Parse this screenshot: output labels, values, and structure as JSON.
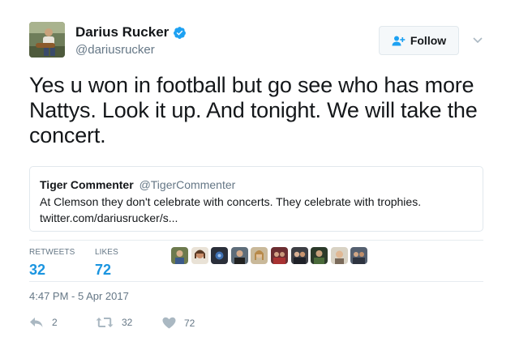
{
  "user": {
    "display_name": "Darius Rucker",
    "handle": "@dariusrucker"
  },
  "follow_label": "Follow",
  "tweet": {
    "text": "Yes u won in football but go see who has more Nattys. Look it up. And tonight. We will take the concert."
  },
  "quoted_tweet": {
    "display_name": "Tiger Commenter",
    "handle": "@TigerCommenter",
    "text": "At Clemson they don't celebrate with concerts. They celebrate with trophies.",
    "link": "twitter.com/dariusrucker/s..."
  },
  "stats": {
    "retweets_label": "RETWEETS",
    "retweets_count": "32",
    "likes_label": "LIKES",
    "likes_count": "72"
  },
  "timestamp": "4:47 PM - 5 Apr 2017",
  "actions": {
    "reply_count": "2",
    "retweet_count": "32",
    "like_count": "72"
  },
  "colors": {
    "accent": "#1b95e0",
    "verified": "#1da1f2",
    "muted": "#657786",
    "border": "#e1e8ed"
  },
  "icons": [
    "verified-badge-icon",
    "follow-person-icon",
    "chevron-down-icon",
    "reply-icon",
    "retweet-icon",
    "heart-icon"
  ]
}
